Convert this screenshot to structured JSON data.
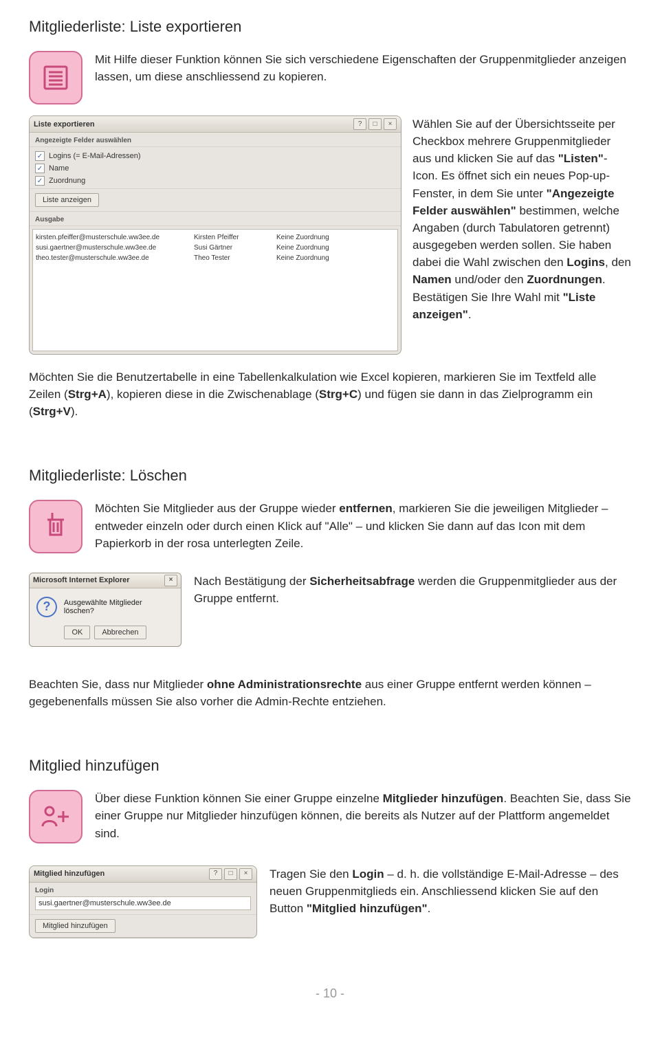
{
  "section1": {
    "heading": "Mitgliederliste: Liste exportieren",
    "intro": "Mit Hilfe dieser Funktion können Sie sich verschiedene Eigenschaften der Gruppenmitglieder anzeigen lassen, um diese anschliessend zu kopieren.",
    "side": {
      "p1a": "Wählen Sie auf der Übersichtsseite per Checkbox mehrere Gruppenmitglieder aus und klicken Sie auf das ",
      "p1b": "\"Listen\"",
      "p1c": "-Icon. Es öffnet sich ein neues Pop-up-Fenster, in dem Sie unter ",
      "p1d": "\"Angezeigte Felder auswählen\"",
      "p1e": " bestimmen, welche Angaben (durch Tabulatoren getrennt) ausgegeben werden sollen. Sie haben dabei die Wahl zwischen den ",
      "p1f": "Logins",
      "p1g": ", den ",
      "p1h": "Namen",
      "p1i": " und/oder den ",
      "p1j": "Zuordnungen",
      "p1k": ". Bestätigen Sie Ihre Wahl mit ",
      "p1l": "\"Liste anzeigen\"",
      "p1m": "."
    },
    "after": {
      "a": "Möchten Sie die Benutzertabelle in eine Tabellenkalkulation wie Excel kopieren, markieren Sie im Textfeld alle Zeilen (",
      "b": "Strg+A",
      "c": "), kopieren diese in die Zwischenablage (",
      "d": "Strg+C",
      "e": ") und fügen sie dann in das Zielprogramm ein (",
      "f": "Strg+V",
      "g": ")."
    }
  },
  "exportWin": {
    "title": "Liste exportieren",
    "fieldsLabel": "Angezeigte Felder auswählen",
    "chk1": "Logins (= E-Mail-Adressen)",
    "chk2": "Name",
    "chk3": "Zuordnung",
    "showBtn": "Liste anzeigen",
    "outLabel": "Ausgabe",
    "rows": [
      {
        "c1": "kirsten.pfeiffer@musterschule.ww3ee.de",
        "c2": "Kirsten Pfeiffer",
        "c3": "Keine Zuordnung"
      },
      {
        "c1": "susi.gaertner@musterschule.ww3ee.de",
        "c2": "Susi Gärtner",
        "c3": "Keine Zuordnung"
      },
      {
        "c1": "theo.tester@musterschule.ww3ee.de",
        "c2": "Theo Tester",
        "c3": "Keine Zuordnung"
      }
    ]
  },
  "section2": {
    "heading": "Mitgliederliste: Löschen",
    "p1a": "Möchten Sie Mitglieder aus der Gruppe wieder ",
    "p1b": "entfernen",
    "p1c": ", markieren Sie die jeweiligen Mitglieder – entweder einzeln oder durch einen Klick auf \"Alle\" – und klicken Sie dann auf das Icon mit dem Papierkorb in der rosa unterlegten Zeile.",
    "p2a": "Nach Bestätigung der ",
    "p2b": "Sicherheitsabfrage",
    "p2c": " werden die Gruppenmitglieder aus der Gruppe entfernt.",
    "note1a": "Beachten Sie, dass nur Mitglieder ",
    "note1b": "ohne Administrationsrechte",
    "note1c": " aus einer Gruppe entfernt werden können – gegebenenfalls müssen Sie also vorher die Admin-Rechte entziehen."
  },
  "confirm": {
    "title": "Microsoft Internet Explorer",
    "msg": "Ausgewählte Mitglieder löschen?",
    "ok": "OK",
    "cancel": "Abbrechen"
  },
  "section3": {
    "heading": "Mitglied hinzufügen",
    "p1a": "Über diese Funktion können Sie einer Gruppe einzelne ",
    "p1b": "Mitglieder hinzufügen",
    "p1c": ". Beachten Sie, dass Sie einer Gruppe nur Mitglieder hinzufügen können, die bereits als Nutzer auf der Plattform angemeldet sind.",
    "p2a": "Tragen Sie den ",
    "p2b": "Login",
    "p2c": " – d. h. die vollständige E-Mail-Adresse – des neuen Gruppenmitglieds ein. Anschliessend klicken Sie auf den Button ",
    "p2d": "\"Mitglied hinzufügen\"",
    "p2e": "."
  },
  "addWin": {
    "title": "Mitglied hinzufügen",
    "loginLabel": "Login",
    "value": "susi.gaertner@musterschule.ww3ee.de",
    "btn": "Mitglied hinzufügen"
  },
  "pagenum": "- 10 -"
}
